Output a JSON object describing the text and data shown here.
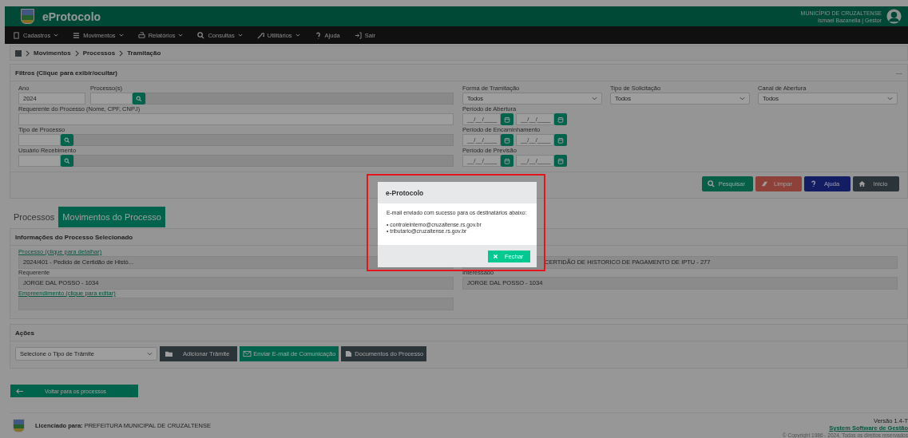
{
  "header": {
    "title": "eProtocolo",
    "municipality": "MUNICÍPIO DE CRUZALTENSE",
    "user": "Ismael Bazanella | Gestor"
  },
  "nav": [
    {
      "label": "Cadastros",
      "has_menu": true
    },
    {
      "label": "Movimentos",
      "has_menu": true
    },
    {
      "label": "Relatórios",
      "has_menu": true
    },
    {
      "label": "Consultas",
      "has_menu": true
    },
    {
      "label": "Utilitários",
      "has_menu": true
    },
    {
      "label": "Ajuda",
      "has_menu": false
    },
    {
      "label": "Sair",
      "has_menu": false
    }
  ],
  "breadcrumb": [
    "Movimentos",
    "Processos",
    "Tramitação"
  ],
  "filters": {
    "title": "Filtros (Clique para exibir/ocultar)",
    "collapse": "—",
    "ano": {
      "label": "Ano",
      "value": "2024"
    },
    "processos": {
      "label": "Processo(s)"
    },
    "requerente": {
      "label": "Requerente do Processo (Nome, CPF, CNPJ)"
    },
    "tipo_processo": {
      "label": "Tipo de Processo"
    },
    "usuario": {
      "label": "Usuário Recebimento"
    },
    "selects": [
      {
        "label": "Forma de Tramitação",
        "value": "Todos"
      },
      {
        "label": "Tipo de Solicitação",
        "value": "Todos"
      },
      {
        "label": "Canal de Abertura",
        "value": "Todos"
      }
    ],
    "periods": [
      {
        "label": "Período de Abertura",
        "from": "__/__/____",
        "to": "__/__/____"
      },
      {
        "label": "Período de Encaminhamento",
        "from": "__/__/____",
        "to": "__/__/____"
      },
      {
        "label": "Período de Previsão",
        "from": "__/__/____",
        "to": "__/__/____"
      }
    ],
    "buttons": [
      {
        "label": "Pesquisar",
        "kind": "search"
      },
      {
        "label": "Limpar",
        "kind": "clear"
      },
      {
        "label": "Ajuda",
        "kind": "help"
      },
      {
        "label": "Início",
        "kind": "home"
      }
    ]
  },
  "tabs": [
    {
      "label": "Processos",
      "selected": false
    },
    {
      "label": "Movimentos do Processo",
      "selected": true
    }
  ],
  "info": {
    "title": "Informações do Processo Selecionado",
    "processo_link": "Processo (clique para detalhar)",
    "processo": "2024/401 - Pedido de Certidão de Histó...",
    "processo_desc": "CERTIDÃO DE HISTORICO DE PAGAMENTO DE IPTU - 277",
    "requerente_label": "Requerente",
    "requerente": "JORGE DAL POSSO - 1034",
    "interessado_label": "Interessado",
    "interessado": "JORGE DAL POSSO - 1034",
    "empreendimento_link": "Empreendimento (clique para editar)"
  },
  "actions": {
    "title": "Ações",
    "select": "Selecione o Tipo de Trâmite",
    "buttons": [
      {
        "label": "Adicionar Trâmite",
        "kind": "add"
      },
      {
        "label": "Enviar E-mail de Comunicação",
        "kind": "email"
      },
      {
        "label": "Documentos do Processo",
        "kind": "docs"
      }
    ]
  },
  "back_button": "Voltar para os processos",
  "footer": {
    "licensed": "**Licenciado para:** PREFEITURA MUNICIPAL DE CRUZALTENSE",
    "version": "Versão 1.4-T",
    "company": "System Software de Gestão",
    "copyright": "© Copyright 1986 - 2024. Todos os direitos reservados"
  },
  "modal": {
    "title": "e-Protocolo",
    "message": "E-mail enviado com sucesso para os destinatários abaixo:",
    "recipients": [
      "• controleinterno@cruzaltense.rs.gov.br",
      "• tributario@cruzaltense.rs.gov.br"
    ],
    "close_button": "Fechar"
  }
}
